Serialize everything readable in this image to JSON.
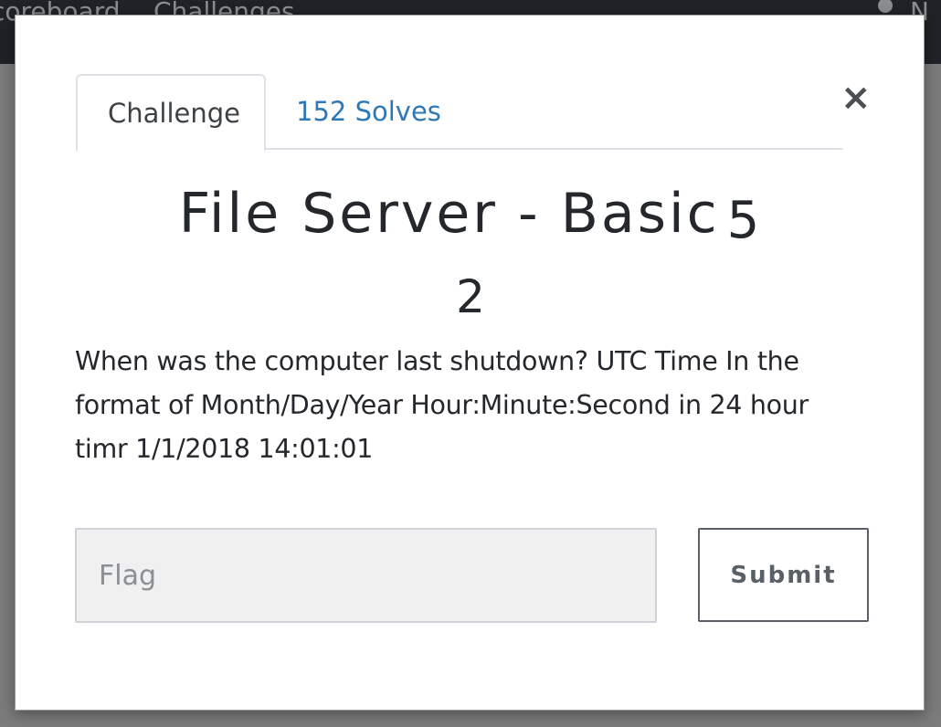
{
  "navbar": {
    "links": [
      "coreboard",
      "Challenges"
    ],
    "user_label": "N",
    "user_icon": "user-icon"
  },
  "modal": {
    "tabs": [
      {
        "label": "Challenge",
        "active": true
      },
      {
        "label": "152 Solves",
        "active": false
      }
    ],
    "close_label": "×",
    "title_main": "File Server - Basic",
    "title_suffix": "5",
    "points": "2",
    "description": "When was the computer last shutdown? UTC Time In the format of Month/Day/Year Hour:Minute:Second in 24 hour timr 1/1/2018 14:01:01",
    "flag_input": {
      "value": "",
      "placeholder": "Flag"
    },
    "submit_label": "Submit"
  },
  "colors": {
    "link": "#2e78b7",
    "text": "#24282c",
    "overlay": "#7b7b7b",
    "navbar": "#1f2226"
  }
}
